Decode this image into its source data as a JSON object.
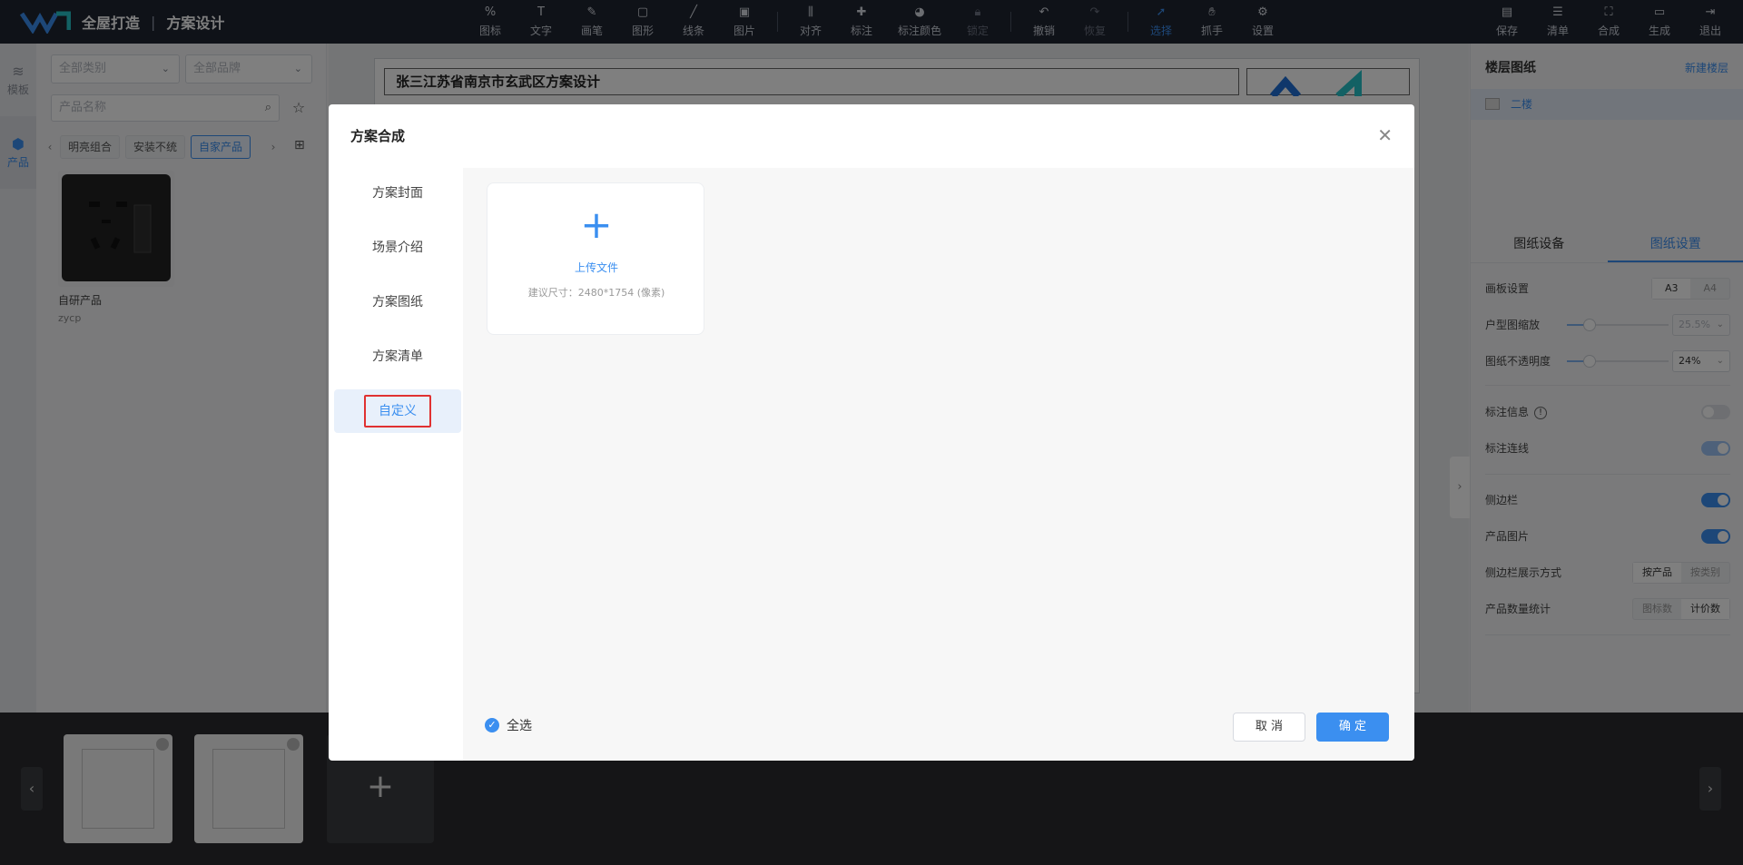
{
  "app": {
    "brand_name": "全屋打造",
    "brand_sep": "|",
    "brand_sub": "方案设计"
  },
  "toolbar": {
    "tools": [
      {
        "label": "图标",
        "icon": "percent-icon"
      },
      {
        "label": "文字",
        "icon": "text-icon"
      },
      {
        "label": "画笔",
        "icon": "brush-icon"
      },
      {
        "label": "图形",
        "icon": "shape-icon"
      },
      {
        "label": "线条",
        "icon": "line-icon"
      },
      {
        "label": "图片",
        "icon": "image-icon"
      },
      {
        "label": "对齐",
        "icon": "align-icon"
      },
      {
        "label": "标注",
        "icon": "pin-icon"
      },
      {
        "label": "标注颜色",
        "icon": "palette-icon"
      },
      {
        "label": "锁定",
        "icon": "lock-icon"
      },
      {
        "label": "撤销",
        "icon": "undo-icon"
      },
      {
        "label": "恢复",
        "icon": "redo-icon"
      },
      {
        "label": "选择",
        "icon": "cursor-icon"
      },
      {
        "label": "抓手",
        "icon": "hand-icon"
      },
      {
        "label": "设置",
        "icon": "gear-icon"
      }
    ],
    "right": [
      {
        "label": "保存",
        "icon": "save-icon"
      },
      {
        "label": "清单",
        "icon": "list-icon"
      },
      {
        "label": "合成",
        "icon": "compose-icon"
      },
      {
        "label": "生成",
        "icon": "generate-icon"
      },
      {
        "label": "退出",
        "icon": "exit-icon"
      }
    ]
  },
  "rail": {
    "template": "模板",
    "product": "产品"
  },
  "left_panel": {
    "category": "全部类别",
    "brand": "全部品牌",
    "search_placeholder": "产品名称",
    "chips": [
      "明亮组合",
      "安装不统",
      "自家产品"
    ],
    "card_name": "自研产品",
    "card_code": "zycp"
  },
  "canvas": {
    "sheet_title": "张三江苏省南京市玄武区方案设计"
  },
  "right_panel": {
    "title": "楼层图纸",
    "new_floor": "新建楼层",
    "floor": "二楼",
    "tab_devices": "图纸设备",
    "tab_settings": "图纸设置",
    "board_label": "画板设置",
    "board_a3": "A3",
    "board_a4": "A4",
    "scale_label": "户型图缩放",
    "scale_value": "25.5%",
    "opacity_label": "图纸不透明度",
    "opacity_value": "24%",
    "annot_info": "标注信息",
    "annot_line": "标注连线",
    "sidebar": "侧边栏",
    "product_image": "产品图片",
    "sidebar_display": "侧边栏展示方式",
    "by_product": "按产品",
    "by_category": "按类别",
    "count_label": "产品数量统计",
    "count_icon": "图标数",
    "count_price": "计价数"
  },
  "modal": {
    "title": "方案合成",
    "nav": [
      "方案封面",
      "场景介绍",
      "方案图纸",
      "方案清单",
      "自定义"
    ],
    "upload_label": "上传文件",
    "upload_hint": "建议尺寸：2480*1754 (像素)",
    "select_all": "全选",
    "cancel": "取 消",
    "ok": "确 定"
  },
  "colors": {
    "accent": "#3b8ff0",
    "topbar": "#1f2430",
    "highlight_border": "#e03131"
  }
}
